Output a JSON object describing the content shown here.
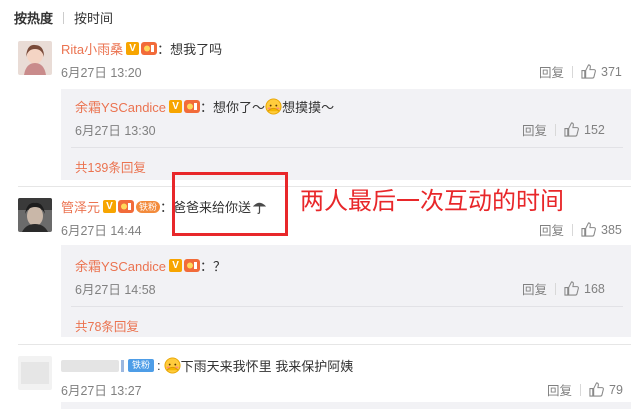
{
  "sort": {
    "hot": "按热度",
    "time": "按时间"
  },
  "comments": [
    {
      "user": "Rita小雨桑",
      "text": "：想我了吗",
      "time": "6月27日 13:20",
      "reply_label": "回复",
      "likes": "371",
      "replies": [
        {
          "user": "余霜YSCandice",
          "text_a": "：想你了～",
          "text_b": "想摸摸～",
          "time": "6月27日 13:30",
          "reply_label": "回复",
          "likes": "152"
        }
      ],
      "more": "共139条回复"
    },
    {
      "user": "管泽元",
      "fan_badge": "铁粉",
      "text": "：爸爸来给你送",
      "time": "6月27日 14:44",
      "reply_label": "回复",
      "likes": "385",
      "replies": [
        {
          "user": "余霜YSCandice",
          "text_a": "：？",
          "time": "6月27日 14:58",
          "reply_label": "回复",
          "likes": "168"
        }
      ],
      "more": "共78条回复"
    },
    {
      "fan_badge": "铁粉",
      "text": "下雨天来我怀里 我来保护阿姨",
      "time": "6月27日 13:27",
      "reply_label": "回复",
      "likes": "79"
    }
  ],
  "annotation": {
    "text": "两人最后一次互动的时间",
    "color": "#e8272a"
  },
  "colors": {
    "username": "#eb7350",
    "meta": "#808080",
    "reply_bg": "#f2f2f5",
    "vip_badge": "#f7a500"
  }
}
